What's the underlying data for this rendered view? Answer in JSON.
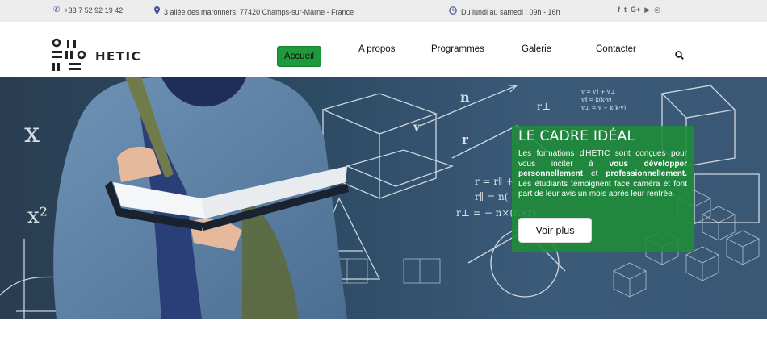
{
  "topbar": {
    "phone": "+33 7 52 92 19 42",
    "address": "3 allée des maronners, 77420 Champs-sur-Marne - France",
    "hours": "Du lundi au samedi : 09h - 16h",
    "socials": [
      {
        "icon": "facebook-icon",
        "glyph": "f"
      },
      {
        "icon": "twitter-icon",
        "glyph": "t"
      },
      {
        "icon": "google-plus-icon",
        "glyph": "G+"
      },
      {
        "icon": "youtube-icon",
        "glyph": "▶"
      },
      {
        "icon": "instagram-icon",
        "glyph": "◎"
      }
    ]
  },
  "logo": {
    "text": "HETIC"
  },
  "nav": {
    "items": [
      {
        "label": "Accueil",
        "active": true
      },
      {
        "label": "A propos"
      },
      {
        "label": "Programmes"
      },
      {
        "label": "Galerie"
      },
      {
        "label": "Contacter"
      }
    ]
  },
  "hero": {
    "title": "LE CADRE IDÉAL",
    "text_1": "Les formations d'HETIC sont conçues pour vous inciter à ",
    "bold_1": "vous développer personnellement",
    "text_2": " et ",
    "bold_2": "professionnellement.",
    "text_3": " Les étudiants témoignent face caméra et font part de leur avis un mois après leur rentrée.",
    "button": "Voir plus"
  },
  "colors": {
    "accent": "#1f9a3a",
    "icon": "#4a4f9a",
    "topbar_bg": "#ececec"
  }
}
